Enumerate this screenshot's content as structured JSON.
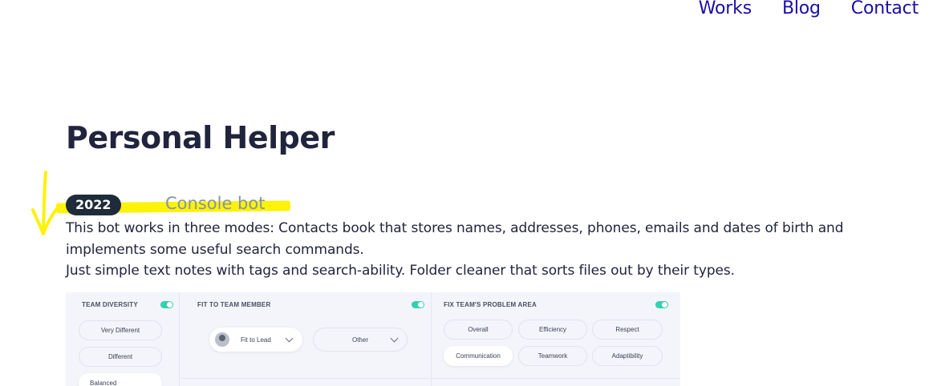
{
  "nav": {
    "items": [
      {
        "label": "Works"
      },
      {
        "label": "Blog"
      },
      {
        "label": "Contact"
      }
    ]
  },
  "project": {
    "title": "Personal Helper",
    "year": "2022",
    "type": "Console bot",
    "description_line1": "This bot works in three modes: Contacts book that stores names, addresses, phones, emails and dates of birth and implements some useful search commands.",
    "description_line2": "Just simple text notes with tags and search-ability. Folder cleaner that sorts files out by their types."
  },
  "annotation_color": "#fdf20a",
  "preview": {
    "team_diversity": {
      "heading": "TEAM DIVERSITY",
      "options": [
        "Very Different",
        "Different",
        "Balanced"
      ],
      "selected": "Balanced"
    },
    "fit_to_team_member": {
      "heading": "FIT TO TEAM MEMBER",
      "dropdown1": "Fit to Lead",
      "dropdown2": "Other"
    },
    "fix_team_problem_area": {
      "heading": "FIX TEAM'S PROBLEM AREA",
      "options": [
        "Overall",
        "Efficiency",
        "Respect",
        "Communication",
        "Teamwork",
        "Adaptibility"
      ],
      "selected": "Communication"
    },
    "accent_color": "#35d0b0"
  }
}
